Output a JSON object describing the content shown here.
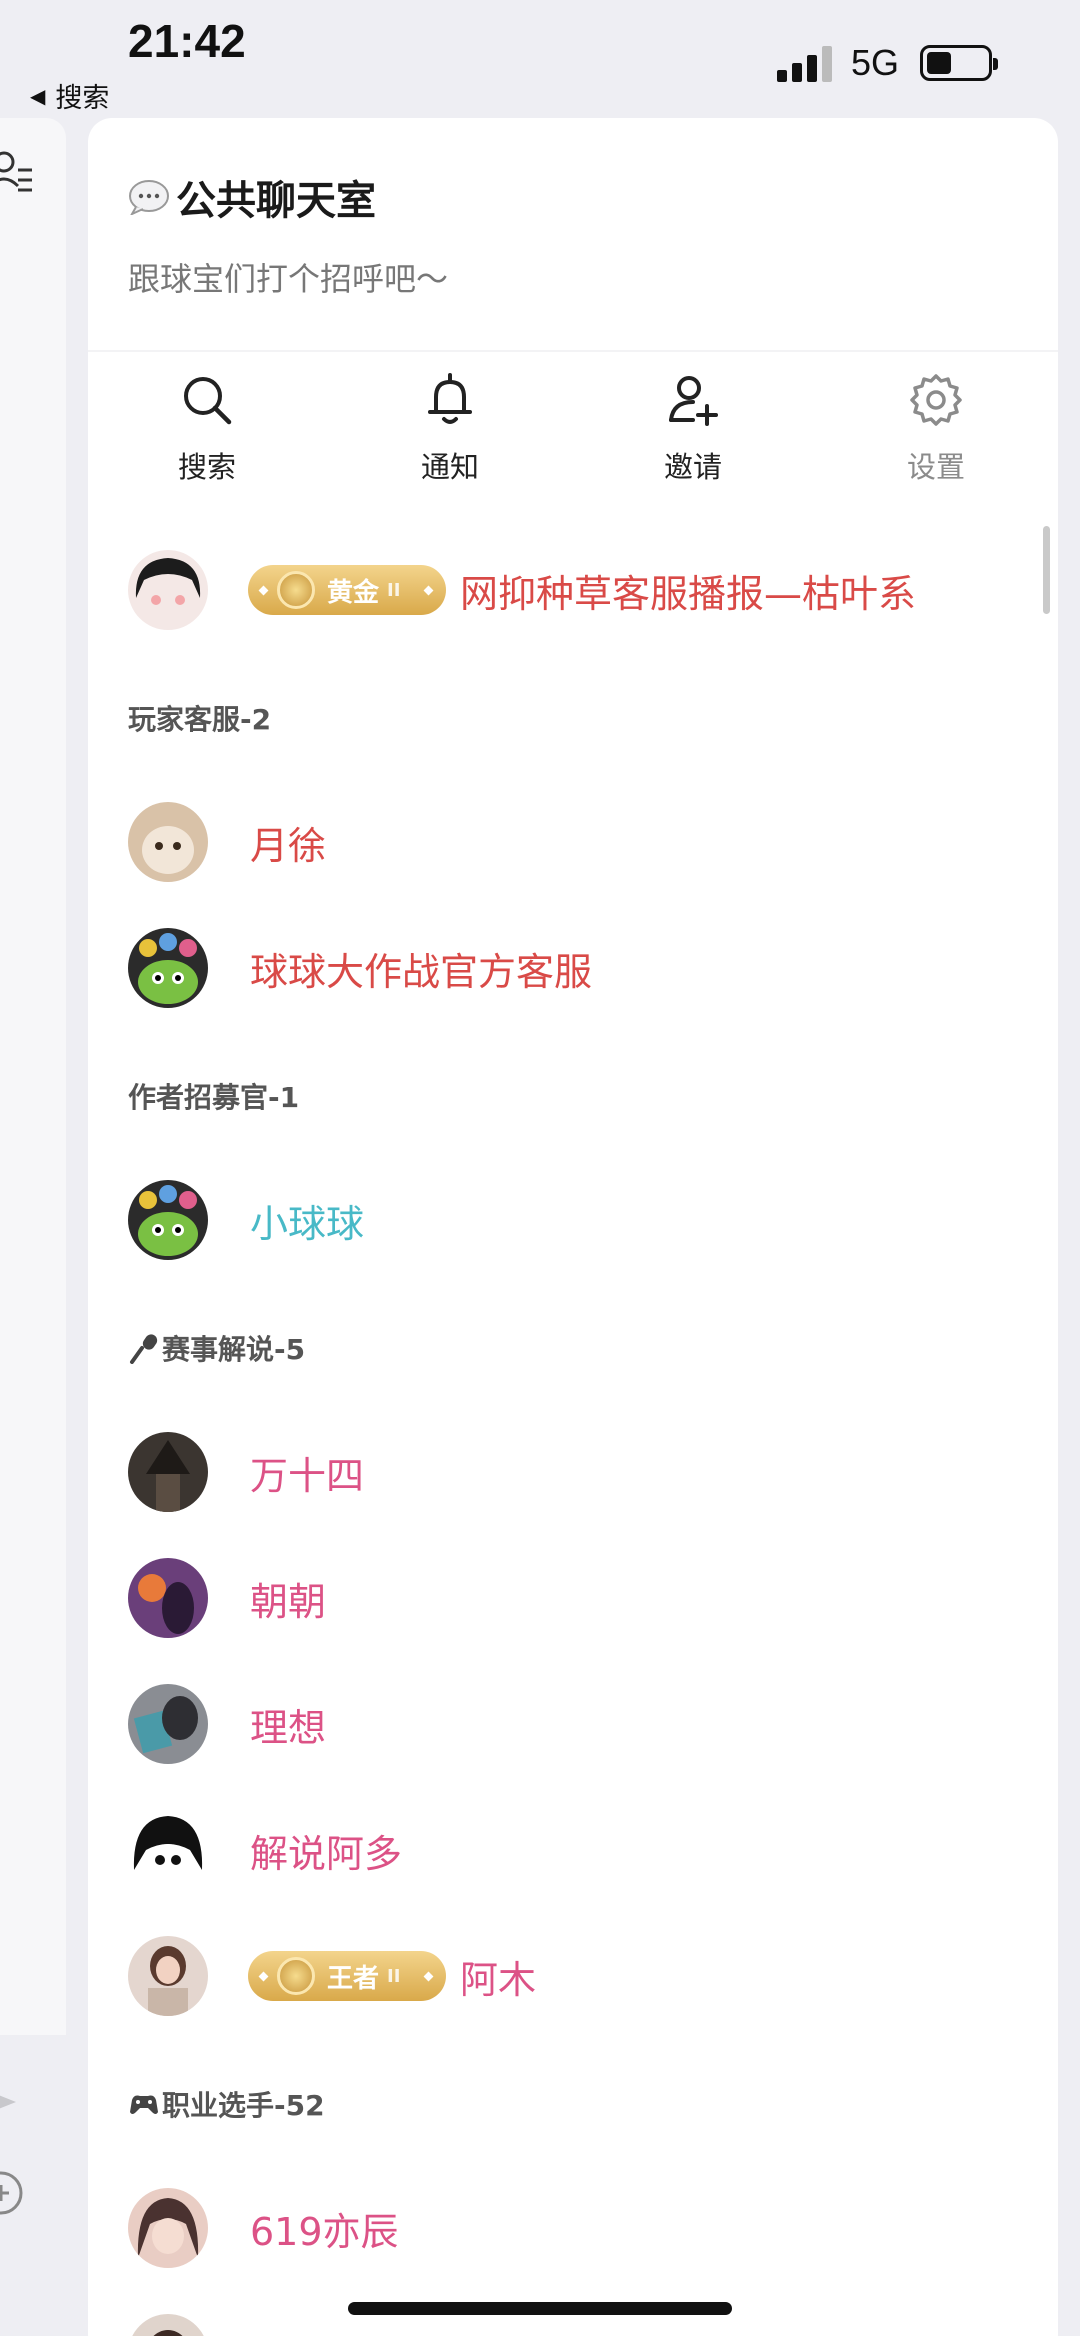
{
  "status_bar": {
    "time": "21:42",
    "back_label": "搜索",
    "network": "5G"
  },
  "room": {
    "title": "公共聊天室",
    "subtitle": "跟球宝们打个招呼吧～"
  },
  "toolbar": [
    {
      "label": "搜索",
      "icon": "search-icon"
    },
    {
      "label": "通知",
      "icon": "bell-icon"
    },
    {
      "label": "邀请",
      "icon": "add-user-icon"
    },
    {
      "label": "设置",
      "icon": "gear-icon"
    }
  ],
  "members": {
    "top": {
      "badge": "黄金",
      "name": "网抑种草客服播报—枯叶系"
    },
    "groups": [
      {
        "label": "玩家客服-2",
        "members": [
          "月徐",
          "球球大作战官方客服"
        ]
      },
      {
        "label": "作者招募官-1",
        "members": [
          "小球球"
        ]
      },
      {
        "label": "赛事解说-5",
        "members": [
          "万十四",
          "朝朝",
          "理想",
          "解说阿多",
          "阿木"
        ],
        "badge_on_last": "王者"
      },
      {
        "label": "职业选手-52",
        "members": [
          "619亦辰"
        ]
      }
    ]
  },
  "colors": {
    "customer_service": "#d94a47",
    "recruiter": "#48b9c7",
    "commentator": "#dc5286",
    "badge_gold": "#d9a94a"
  }
}
